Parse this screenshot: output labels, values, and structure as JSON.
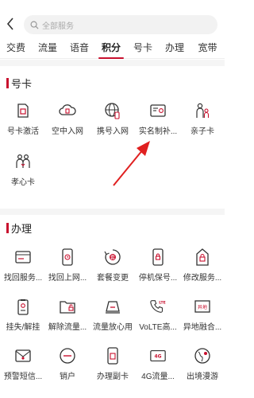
{
  "search": {
    "placeholder": "全部服务"
  },
  "tabs": [
    "交费",
    "流量",
    "语音",
    "积分",
    "号卡",
    "办理",
    "宽带"
  ],
  "active_tab": "积分",
  "accent_color": "#c8102e",
  "sections": {
    "haoka": {
      "title": "号卡",
      "items": [
        {
          "label": "号卡激活",
          "icon": "sim-card-icon"
        },
        {
          "label": "空中入网",
          "icon": "cloud-sim-icon"
        },
        {
          "label": "携号入网",
          "icon": "globe-phone-icon"
        },
        {
          "label": "实名制补...",
          "icon": "id-card-icon"
        },
        {
          "label": "亲子卡",
          "icon": "parent-child-icon"
        },
        {
          "label": "孝心卡",
          "icon": "elder-card-icon"
        }
      ]
    },
    "banli": {
      "title": "办理",
      "items": [
        {
          "label": "找回服务...",
          "icon": "service-card-icon"
        },
        {
          "label": "找回上网...",
          "icon": "phone-clock-icon"
        },
        {
          "label": "套餐变更",
          "icon": "package-change-icon"
        },
        {
          "label": "停机保号...",
          "icon": "phone-lock-icon"
        },
        {
          "label": "修改服务...",
          "icon": "lock-edit-icon"
        },
        {
          "label": "挂失/解挂",
          "icon": "badge-lock-icon"
        },
        {
          "label": "解除流量...",
          "icon": "folder-unlock-icon"
        },
        {
          "label": "流量放心用",
          "icon": "data-assured-icon"
        },
        {
          "label": "VoLTE高...",
          "icon": "volte-phone-icon"
        },
        {
          "label": "异地融合...",
          "icon": "remote-merge-icon"
        },
        {
          "label": "预警短信...",
          "icon": "sms-alert-icon"
        },
        {
          "label": "销户",
          "icon": "cancel-account-icon"
        },
        {
          "label": "办理副卡",
          "icon": "sub-card-icon"
        },
        {
          "label": "4G流量...",
          "icon": "4g-data-icon"
        },
        {
          "label": "出境漫游",
          "icon": "roaming-globe-icon"
        }
      ]
    }
  },
  "icons_text": {
    "yidi": "异地",
    "lte": "LTE",
    "g4": "4G"
  }
}
